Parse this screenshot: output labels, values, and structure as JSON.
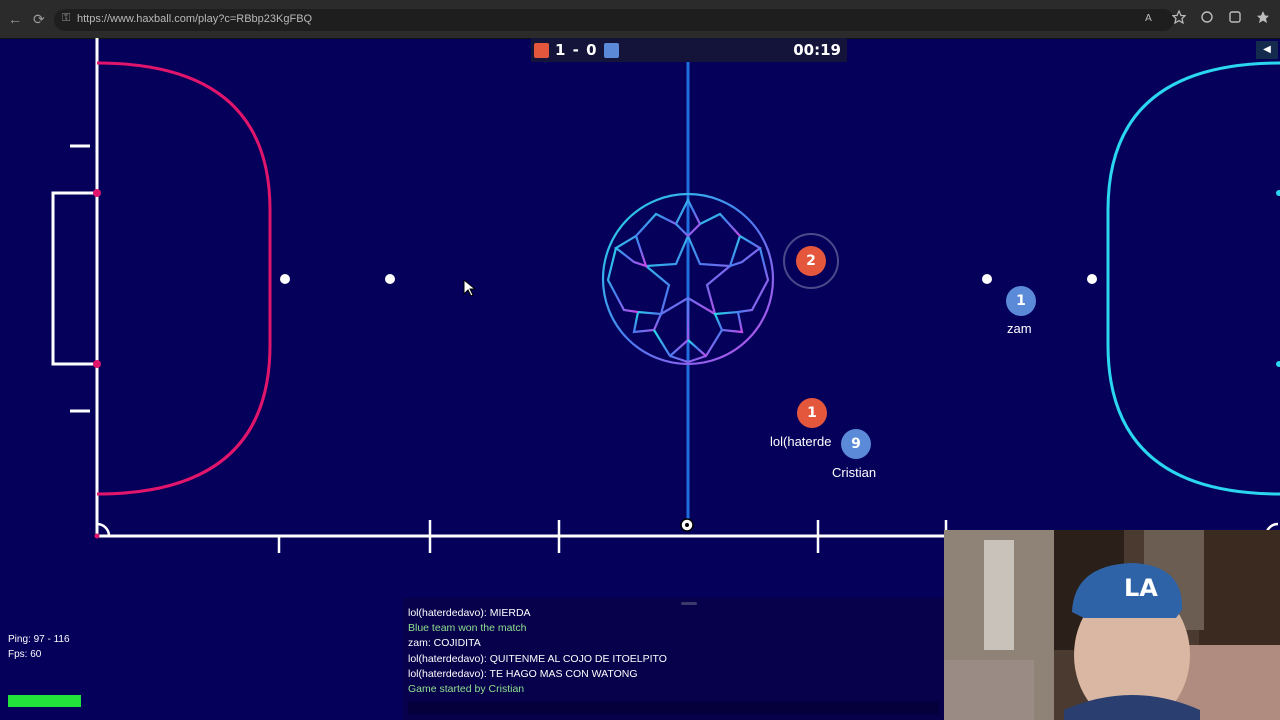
{
  "browser": {
    "url": "https://www.haxball.com/play?c=RBbp23KgFBQ",
    "back_glyph": "←",
    "reload_glyph": "⟳",
    "lock_glyph": "⚿"
  },
  "scoreboard": {
    "red_score": "1",
    "separator": "-",
    "blue_score": "0",
    "time": "00:19",
    "red_color": "#e4573d",
    "blue_color": "#5b8ad8"
  },
  "players": [
    {
      "team": "red",
      "number": "2",
      "name": ""
    },
    {
      "team": "blue",
      "number": "1",
      "name": "zam"
    },
    {
      "team": "red",
      "number": "1",
      "name": "lol(haterde"
    },
    {
      "team": "blue",
      "number": "9",
      "name": "Cristian"
    }
  ],
  "stats": {
    "ping": "Ping: 97 - 116",
    "fps": "Fps: 60"
  },
  "chat": [
    {
      "type": "msg",
      "text": "lol(haterdedavo): MIERDA"
    },
    {
      "type": "notice",
      "text": "Blue team won the match"
    },
    {
      "type": "msg",
      "text": "zam: COJIDITA"
    },
    {
      "type": "msg",
      "text": "lol(haterdedavo): QUITENME AL COJO DE ITOELPITO"
    },
    {
      "type": "msg",
      "text": "lol(haterdedavo): TE HAGO MAS CON WATONG"
    },
    {
      "type": "notice",
      "text": "Game started by Cristian"
    }
  ],
  "colors": {
    "field": "#05005a",
    "left_area": "#e0156b",
    "right_area": "#2ad6f0",
    "center_line": "#1f6fe0"
  }
}
